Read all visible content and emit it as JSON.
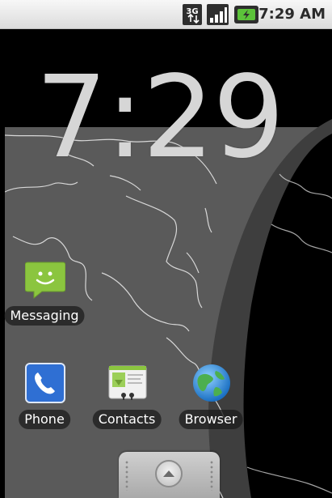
{
  "status_bar": {
    "network_type": "3G",
    "icons": [
      "3g-network-icon",
      "signal-strength-icon",
      "battery-charging-icon"
    ],
    "time": "7:29 AM"
  },
  "clock": {
    "time": "7:29"
  },
  "shortcuts": [
    {
      "id": "messaging",
      "label": "Messaging",
      "icon": "messaging-icon"
    },
    {
      "id": "phone",
      "label": "Phone",
      "icon": "phone-icon"
    },
    {
      "id": "contacts",
      "label": "Contacts",
      "icon": "contacts-icon"
    },
    {
      "id": "browser",
      "label": "Browser",
      "icon": "browser-globe-icon"
    }
  ],
  "drawer": {
    "icon": "chevron-up-icon"
  },
  "colors": {
    "wallpaper_land": "#5a5a5a",
    "night_side": "#000000",
    "messaging_green": "#8bc53f",
    "phone_blue": "#2f6fd3",
    "status_bar_bg": "#e6e6e6"
  }
}
